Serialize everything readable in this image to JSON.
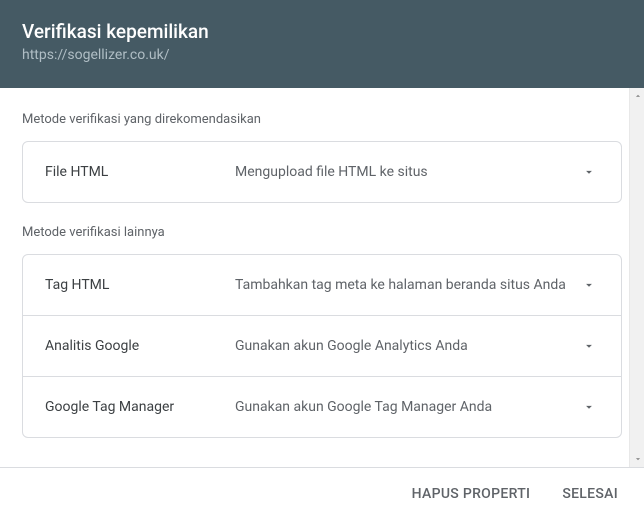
{
  "header": {
    "title": "Verifikasi kepemilikan",
    "subtitle": "https://sogellizer.co.uk/"
  },
  "recommended": {
    "label": "Metode verifikasi yang direkomendasikan",
    "methods": [
      {
        "name": "File HTML",
        "desc": "Mengupload file HTML ke situs"
      }
    ]
  },
  "other": {
    "label": "Metode verifikasi lainnya",
    "methods": [
      {
        "name": "Tag HTML",
        "desc": "Tambahkan tag meta ke halaman beranda situs Anda"
      },
      {
        "name": "Analitis Google",
        "desc": "Gunakan akun Google Analytics Anda"
      },
      {
        "name": "Google Tag Manager",
        "desc": "Gunakan akun Google Tag Manager Anda"
      }
    ]
  },
  "footer": {
    "remove": "HAPUS PROPERTI",
    "done": "SELESAI"
  }
}
